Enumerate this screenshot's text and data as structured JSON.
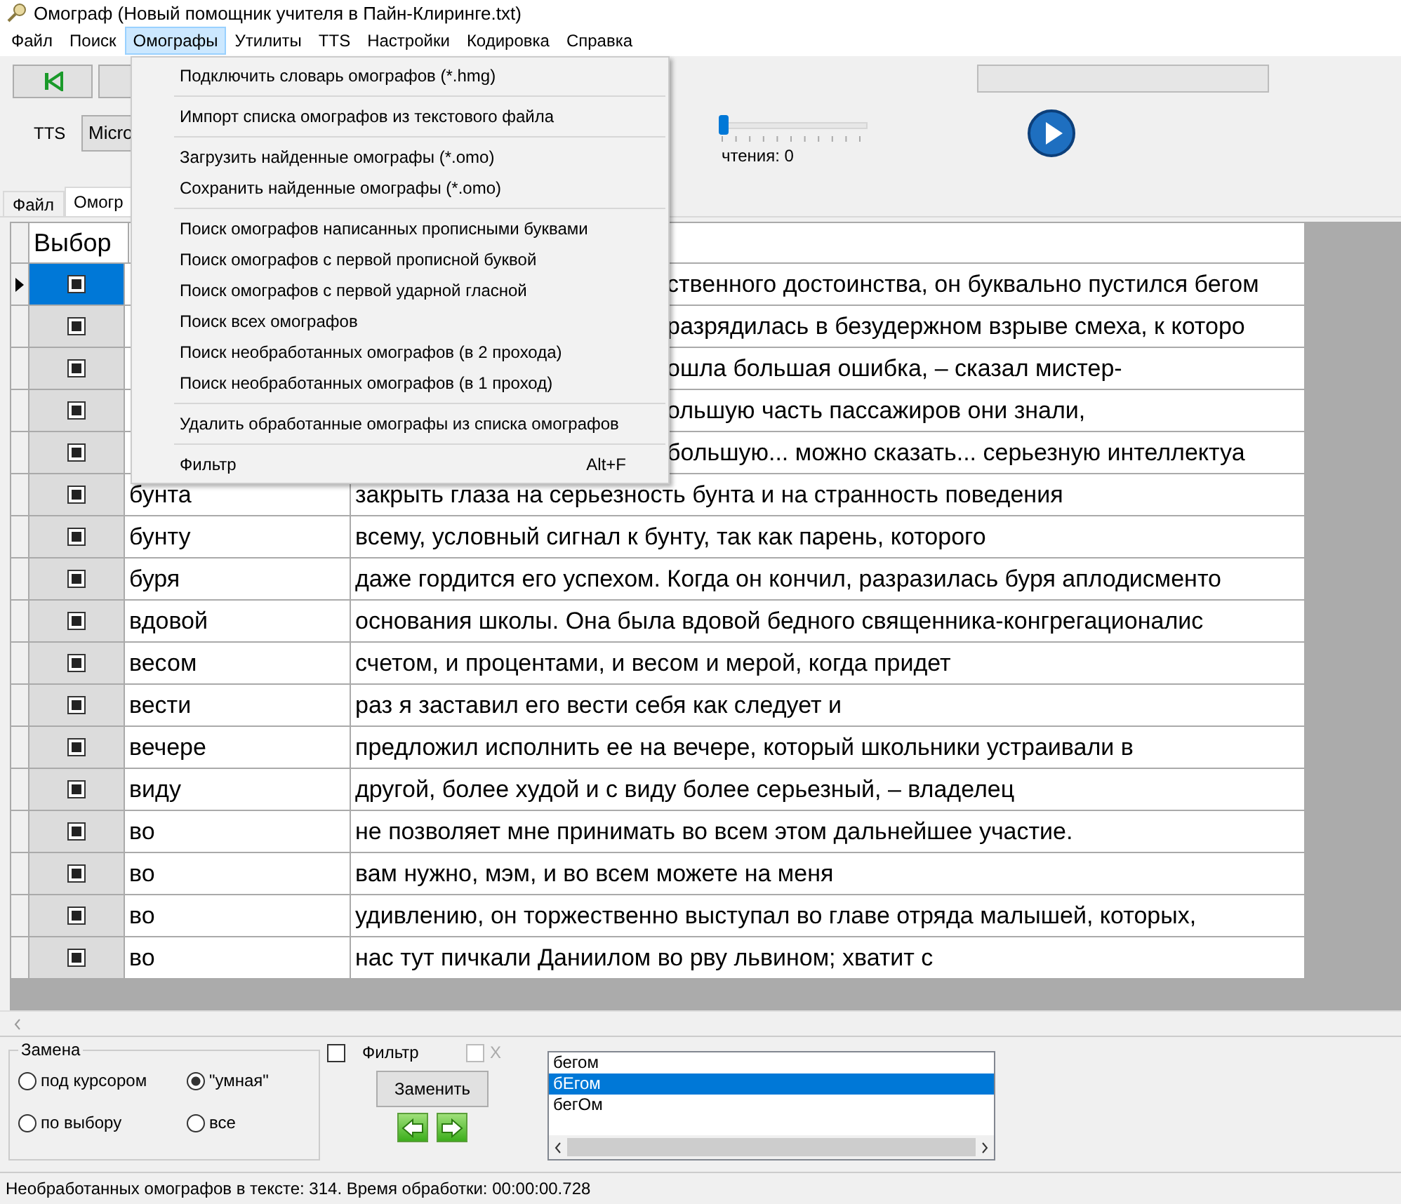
{
  "window": {
    "title": "Омограф (Новый помощник учителя в Пайн-Клиринге.txt)"
  },
  "menubar": [
    {
      "label": "Файл",
      "selected": false
    },
    {
      "label": "Поиск",
      "selected": false
    },
    {
      "label": "Омографы",
      "selected": true
    },
    {
      "label": "Утилиты",
      "selected": false
    },
    {
      "label": "TTS",
      "selected": false
    },
    {
      "label": "Настройки",
      "selected": false
    },
    {
      "label": "Кодировка",
      "selected": false
    },
    {
      "label": "Справка",
      "selected": false
    }
  ],
  "menu": [
    {
      "kind": "item",
      "label": "Подключить словарь омографов (*.hmg)"
    },
    {
      "kind": "separator"
    },
    {
      "kind": "item",
      "label": "Импорт списка омографов из текстового файла"
    },
    {
      "kind": "separator"
    },
    {
      "kind": "item",
      "label": "Загрузить найденные омографы (*.omo)"
    },
    {
      "kind": "item",
      "label": "Сохранить найденные омографы (*.omo)"
    },
    {
      "kind": "separator"
    },
    {
      "kind": "item",
      "label": "Поиск омографов написанных прописными буквами"
    },
    {
      "kind": "item",
      "label": "Поиск омографов с первой прописной буквой"
    },
    {
      "kind": "item",
      "label": "Поиск омографов с первой ударной гласной"
    },
    {
      "kind": "item",
      "label": "Поиск всех омографов"
    },
    {
      "kind": "item",
      "label": "Поиск необработанных омографов (в 2 прохода)"
    },
    {
      "kind": "item",
      "label": "Поиск необработанных омографов (в 1 проход)"
    },
    {
      "kind": "separator"
    },
    {
      "kind": "item",
      "label": "Удалить обработанные омографы из списка омографов"
    },
    {
      "kind": "separator"
    },
    {
      "kind": "item",
      "label": "Фильтр",
      "shortcut": "Alt+F"
    }
  ],
  "tts": {
    "label": "TTS",
    "voice": "Micro",
    "speed": {
      "level": 0
    },
    "reading": "чтения: 0",
    "progress": {
      "level": 0
    }
  },
  "tabs": [
    {
      "label": "Файл",
      "selected": false
    },
    {
      "label": "Омогр",
      "selected": true
    }
  ],
  "table": {
    "columns": [
      "Выбор"
    ],
    "rows": [
      {
        "checked": true,
        "selected": true,
        "covered": true,
        "text": "ственного достоинства, он буквально пустился бегом"
      },
      {
        "checked": true,
        "selected": false,
        "covered": true,
        "text": "разрядилась в безудержном взрыве смеха, к которо"
      },
      {
        "checked": true,
        "selected": false,
        "covered": true,
        "text": "ошла большая ошибка, – сказал мистер-"
      },
      {
        "checked": true,
        "selected": false,
        "covered": true,
        "text": "ольшую часть пассажиров они знали,"
      },
      {
        "checked": true,
        "selected": false,
        "covered": true,
        "text": "большую... можно сказать... серьезную интеллектуа"
      },
      {
        "checked": true,
        "selected": false,
        "covered": false,
        "word": "бунта",
        "text": "закрыть глаза на серьезность бунта и на странность поведения"
      },
      {
        "checked": true,
        "selected": false,
        "covered": false,
        "word": "бунту",
        "text": "всему, условный сигнал к бунту, так как парень, которого"
      },
      {
        "checked": true,
        "selected": false,
        "covered": false,
        "word": "буря",
        "text": "даже гордится его успехом. Когда он кончил, разразилась буря аплодисменто"
      },
      {
        "checked": true,
        "selected": false,
        "covered": false,
        "word": "вдовой",
        "text": "основания школы. Она была вдовой бедного священника-конгрегационалис"
      },
      {
        "checked": true,
        "selected": false,
        "covered": false,
        "word": "весом",
        "text": "счетом, и процентами, и весом и мерой, когда придет"
      },
      {
        "checked": true,
        "selected": false,
        "covered": false,
        "word": "вести",
        "text": "раз я заставил его вести себя как следует и"
      },
      {
        "checked": true,
        "selected": false,
        "covered": false,
        "word": "вечере",
        "text": "предложил исполнить ее на вечере, который школьники устраивали в"
      },
      {
        "checked": true,
        "selected": false,
        "covered": false,
        "word": "виду",
        "text": "другой, более худой и с виду более серьезный, – владелец"
      },
      {
        "checked": true,
        "selected": false,
        "covered": false,
        "word": "во",
        "text": "не позволяет мне принимать во всем этом дальнейшее участие."
      },
      {
        "checked": true,
        "selected": false,
        "covered": false,
        "word": "во",
        "text": "вам нужно, мэм, и во всем можете на меня"
      },
      {
        "checked": true,
        "selected": false,
        "covered": false,
        "word": "во",
        "text": "удивлению, он торжественно выступал во главе отряда малышей, которых,"
      },
      {
        "checked": true,
        "selected": false,
        "covered": false,
        "word": "во",
        "text": "нас тут пичкали Даниилом во рву львином; хватит с"
      }
    ]
  },
  "replace": {
    "title": "Замена",
    "modes": [
      {
        "label": "под курсором",
        "selected": false
      },
      {
        "label": "\"умная\"",
        "selected": true
      },
      {
        "label": "по выбору",
        "selected": false
      },
      {
        "label": "все",
        "selected": false
      }
    ]
  },
  "filter": {
    "label": "Фильтр",
    "checked": false
  },
  "x_option": {
    "label": "X",
    "checked": false,
    "disabled": true
  },
  "replace_button": "Заменить",
  "variants": [
    {
      "label": "бегом",
      "selected": false
    },
    {
      "label": "бЕгом",
      "selected": true
    },
    {
      "label": "бегОм",
      "selected": false
    }
  ],
  "status_bar": "Необработанных омографов в тексте: 314. Время обработки: 00:00:00.728"
}
